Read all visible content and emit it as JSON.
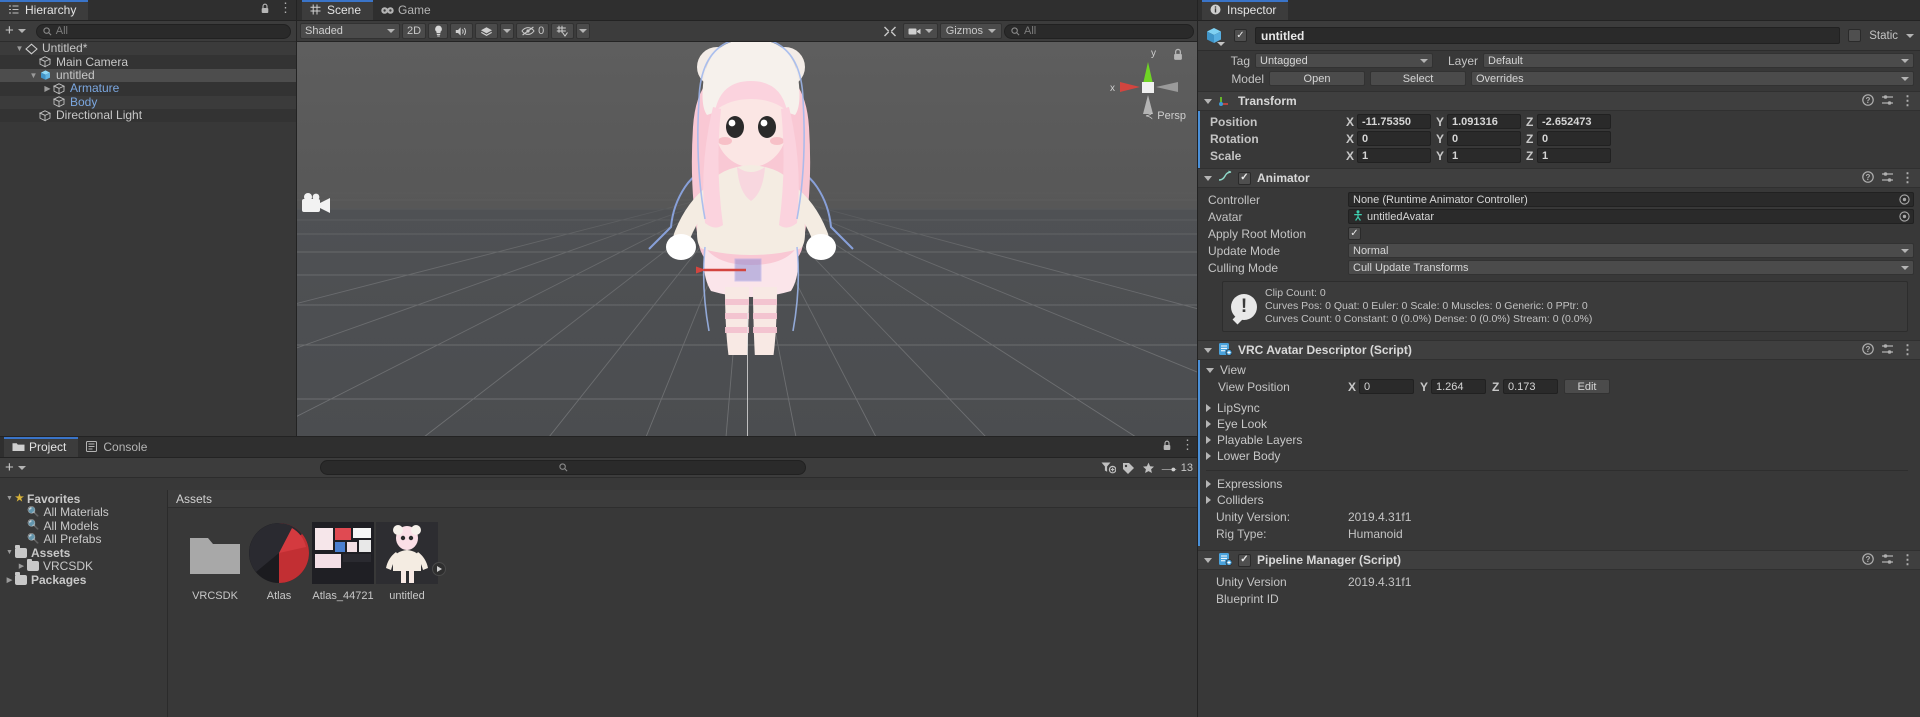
{
  "hierarchy": {
    "tab_label": "Hierarchy",
    "tab_icon": "hierarchy-icon",
    "lock_icon": "lock-icon",
    "menu_icon": "kebab-menu-icon",
    "create_label": "+",
    "search_placeholder": "All",
    "items": [
      {
        "label": "Untitled*",
        "depth": 0,
        "icon": "scene-icon",
        "fold": "down",
        "selected": false,
        "blue": false
      },
      {
        "label": "Main Camera",
        "depth": 1,
        "icon": "gameobject-icon",
        "fold": "none",
        "selected": false,
        "blue": false
      },
      {
        "label": "untitled",
        "depth": 1,
        "icon": "prefab-icon",
        "fold": "down",
        "selected": true,
        "blue": false
      },
      {
        "label": "Armature",
        "depth": 2,
        "icon": "gameobject-icon",
        "fold": "right",
        "selected": false,
        "blue": true
      },
      {
        "label": "Body",
        "depth": 2,
        "icon": "gameobject-icon",
        "fold": "none",
        "selected": false,
        "blue": true
      },
      {
        "label": "Directional Light",
        "depth": 1,
        "icon": "gameobject-icon",
        "fold": "none",
        "selected": false,
        "blue": false
      }
    ]
  },
  "scene": {
    "lock_icon": "lock-icon",
    "menu_icon": "kebab-menu-icon",
    "tabs": [
      {
        "label": "Scene",
        "icon": "scene-grid-icon",
        "active": true
      },
      {
        "label": "Game",
        "icon": "gamepad-icon",
        "active": false
      }
    ],
    "toolbar": {
      "draw_mode": "Shaded",
      "mode_2d": "2D",
      "lighting_icon": "lightbulb-icon",
      "audio_icon": "speaker-icon",
      "fx_icon": "effects-icon",
      "fx_caret": "chevron-down-icon",
      "hidden_icon": "eye-off-icon",
      "hidden_count": "0",
      "grid_icon": "grid-snap-icon",
      "grid_caret": "chevron-down-icon",
      "tools_icon": "wrench-icon",
      "camera_icon": "camera-icon",
      "camera_caret": "chevron-down-icon",
      "gizmos_label": "Gizmos",
      "gizmos_caret": "chevron-down-icon",
      "search_placeholder": "All"
    },
    "gizmo": {
      "axis_y": "y",
      "axis_x": "x",
      "persp_label": "Persp",
      "lock_icon": "lock-icon"
    },
    "camera_gizmo": "scene-camera-gizmo"
  },
  "inspector": {
    "tab_label": "Inspector",
    "tab_icon": "info-icon",
    "object_name": "untitled",
    "object_enabled": true,
    "static_label": "Static",
    "static_checked": false,
    "tag_label": "Tag",
    "tag_value": "Untagged",
    "layer_label": "Layer",
    "layer_value": "Default",
    "model_label": "Model",
    "open_label": "Open",
    "select_label": "Select",
    "overrides_label": "Overrides",
    "transform": {
      "title": "Transform",
      "icon": "transform-icon",
      "help_icon": "help-icon",
      "preset_icon": "preset-icon",
      "menu_icon": "kebab-menu-icon",
      "rows": [
        {
          "label": "Position",
          "x": "-11.75350",
          "y": "1.091316",
          "z": "-2.652473"
        },
        {
          "label": "Rotation",
          "x": "0",
          "y": "0",
          "z": "0"
        },
        {
          "label": "Scale",
          "x": "1",
          "y": "1",
          "z": "1"
        }
      ]
    },
    "animator": {
      "title": "Animator",
      "icon": "animator-icon",
      "enabled": true,
      "help_icon": "help-icon",
      "preset_icon": "preset-icon",
      "menu_icon": "kebab-menu-icon",
      "controller_label": "Controller",
      "controller_value": "None (Runtime Animator Controller)",
      "avatar_label": "Avatar",
      "avatar_value": "untitledAvatar",
      "avatar_icon": "avatar-icon",
      "apply_root_motion_label": "Apply Root Motion",
      "apply_root_motion_checked": true,
      "update_mode_label": "Update Mode",
      "update_mode_value": "Normal",
      "culling_mode_label": "Culling Mode",
      "culling_mode_value": "Cull Update Transforms",
      "info_icon": "warning-icon",
      "info_line1": "Clip Count: 0",
      "info_line2": "Curves Pos: 0 Quat: 0 Euler: 0 Scale: 0 Muscles: 0 Generic: 0 PPtr: 0",
      "info_line3": "Curves Count: 0 Constant: 0 (0.0%) Dense: 0 (0.0%) Stream: 0 (0.0%)"
    },
    "vrc_descriptor": {
      "title": "VRC Avatar Descriptor (Script)",
      "icon": "script-icon",
      "help_icon": "help-icon",
      "preset_icon": "preset-icon",
      "menu_icon": "kebab-menu-icon",
      "view_label": "View",
      "view_position_label": "View Position",
      "view_x": "0",
      "view_y": "1.264",
      "view_z": "0.173",
      "edit_label": "Edit",
      "foldouts": [
        "LipSync",
        "Eye Look",
        "Playable Layers",
        "Lower Body"
      ],
      "foldouts2": [
        "Expressions",
        "Colliders"
      ],
      "unity_version_label": "Unity Version:",
      "unity_version_value": "2019.4.31f1",
      "rig_type_label": "Rig Type:",
      "rig_type_value": "Humanoid"
    },
    "pipeline_manager": {
      "title": "Pipeline Manager (Script)",
      "icon": "script-icon",
      "enabled": true,
      "help_icon": "help-icon",
      "preset_icon": "preset-icon",
      "menu_icon": "kebab-menu-icon",
      "unity_version_label": "Unity Version",
      "unity_version_value": "2019.4.31f1",
      "blueprint_id_label": "Blueprint ID"
    }
  },
  "project": {
    "tabs": [
      {
        "label": "Project",
        "icon": "folder-icon",
        "active": true
      },
      {
        "label": "Console",
        "icon": "console-icon",
        "active": false
      }
    ],
    "lock_icon": "lock-icon",
    "menu_icon": "kebab-menu-icon",
    "create_label": "+",
    "search_placeholder": "",
    "search_icon": "search-icon",
    "filter_type_icon": "filter-type-icon",
    "filter_label_icon": "filter-label-icon",
    "favorite_icon": "star-icon",
    "slider_icon": "zoom-slider-icon",
    "slider_value": "13",
    "tree": [
      {
        "label": "Favorites",
        "depth": 0,
        "icon": "star-icon",
        "fold": "down",
        "bold": true
      },
      {
        "label": "All Materials",
        "depth": 1,
        "icon": "search-icon",
        "fold": "none",
        "bold": false
      },
      {
        "label": "All Models",
        "depth": 1,
        "icon": "search-icon",
        "fold": "none",
        "bold": false
      },
      {
        "label": "All Prefabs",
        "depth": 1,
        "icon": "search-icon",
        "fold": "none",
        "bold": false
      },
      {
        "label": "Assets",
        "depth": 0,
        "icon": "folder-icon",
        "fold": "down",
        "bold": true
      },
      {
        "label": "VRCSDK",
        "depth": 1,
        "icon": "folder-icon",
        "fold": "right",
        "bold": false
      },
      {
        "label": "Packages",
        "depth": 0,
        "icon": "folder-icon",
        "fold": "right",
        "bold": true
      }
    ],
    "breadcrumb": "Assets",
    "assets": [
      {
        "name": "VRCSDK",
        "kind": "folder"
      },
      {
        "name": "Atlas",
        "kind": "material"
      },
      {
        "name": "Atlas_44721",
        "kind": "texture"
      },
      {
        "name": "untitled",
        "kind": "model"
      }
    ]
  },
  "colors": {
    "accent_blue": "#3a74c8",
    "selection": "#4d4d4d",
    "panel_bg": "#383838",
    "toolbar_bg": "#3c3c3c",
    "field_bg": "#2a2a2a",
    "text": "#c4c4c4",
    "link_blue": "#7ba7e0",
    "axis_x": "#d3453f",
    "axis_y": "#6fd424",
    "axis_z": "#9a9a9a"
  }
}
